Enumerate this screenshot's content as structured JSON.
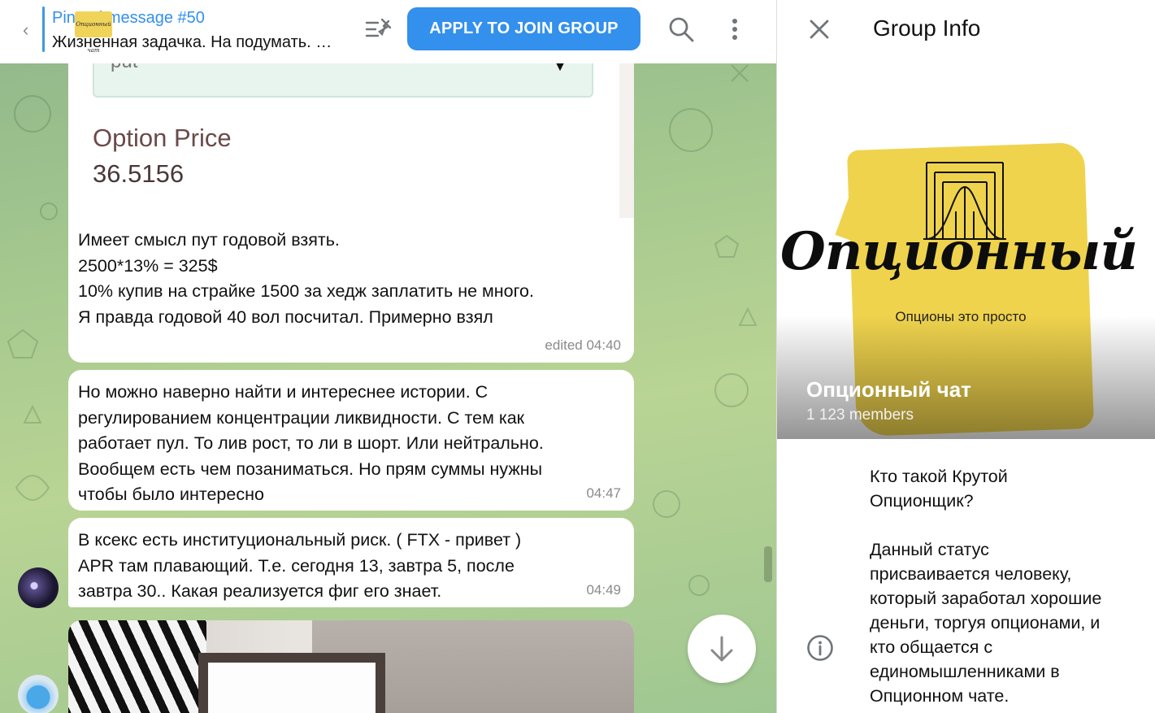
{
  "chat": {
    "pinned": {
      "title": "Pinned message #50",
      "text": "Жизненная задачка. На подумать. …",
      "thumb_label": "Опционный чат"
    },
    "apply_label": "APPLY TO JOIN GROUP",
    "messages": [
      {
        "image": {
          "select_value": "put",
          "option_price_label": "Option Price",
          "option_price_value": "36.5156"
        },
        "lines": [
          "Имеет смысл пут годовой взять.",
          "2500*13% = 325$",
          "10% купив на страйке 1500 за хедж заплатить не много.",
          "Я правда годовой 40 вол посчитал. Примерно взял"
        ],
        "time": "edited 04:40"
      },
      {
        "lines": [
          "Но можно наверно найти и интереснее истории. С",
          "регулированием концентрации ликвидности. С тем как",
          "работает пул. То лив рост, то ли в шорт. Или нейтрально.",
          "Вообщем есть чем позаниматься. Но прям суммы нужны",
          "чтобы было интересно"
        ],
        "time": "04:47"
      },
      {
        "lines": [
          "В ксекс есть институциональный риск. ( FTX - привет )",
          "APR там плавающий. Т.е. сегодня 13, завтра 5, после",
          "завтра 30.. Какая реализуется фиг его знает."
        ],
        "time": "04:49"
      }
    ]
  },
  "info": {
    "title": "Group Info",
    "cover": {
      "logo_text": "Опционный чат",
      "logo_subtitle": "Опционы это просто"
    },
    "group_name": "Опционный чат",
    "members": "1 123 members",
    "description": "Кто такой Крутой\nОпционщик?\n\nДанный статус\nприсваивается человеку,\nкоторый заработал хорошие\nденьги, торгуя опционами, и\nкто общается с\nединомышленниками в\nОпционном чате."
  },
  "icons": [
    "back-icon",
    "pinned-list-icon",
    "search-icon",
    "more-vertical-icon",
    "close-icon",
    "info-icon",
    "arrow-down-icon"
  ],
  "colors": {
    "accent": "#3390ec",
    "logo_yellow": "#efd34d"
  }
}
